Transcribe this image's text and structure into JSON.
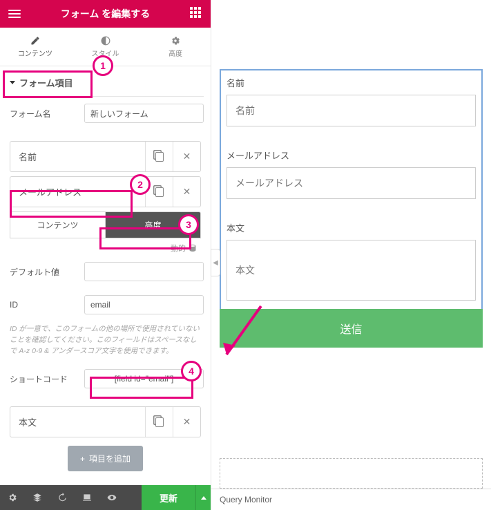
{
  "header": {
    "title": "フォーム を編集する"
  },
  "tabs": [
    {
      "label": "コンテンツ"
    },
    {
      "label": "スタイル"
    },
    {
      "label": "高度"
    }
  ],
  "section": {
    "title": "フォーム項目"
  },
  "form_name": {
    "label": "フォーム名",
    "value": "新しいフォーム"
  },
  "fields": [
    {
      "label": "名前"
    },
    {
      "label": "メールアドレス"
    },
    {
      "label": "本文"
    }
  ],
  "subtabs": [
    {
      "label": "コンテンツ"
    },
    {
      "label": "高度"
    }
  ],
  "dynamic_label": "動的",
  "default_value": {
    "label": "デフォルト値",
    "value": ""
  },
  "id_field": {
    "label": "ID",
    "value": "email"
  },
  "id_help": "ID が一意で、このフォームの他の場所で使用されていないことを確認してください。このフィールドはスペースなしで A-z 0-9 & アンダースコア文字を使用できます。",
  "shortcode": {
    "label": "ショートコード",
    "value": "[field id=\"email\"]"
  },
  "add_item_label": "項目を追加",
  "footer": {
    "update_label": "更新"
  },
  "preview": {
    "fields": [
      {
        "label": "名前",
        "placeholder": "名前"
      },
      {
        "label": "メールアドレス",
        "placeholder": "メールアドレス"
      },
      {
        "label": "本文",
        "placeholder": "本文"
      }
    ],
    "submit_label": "送信",
    "qm_label": "Query Monitor"
  },
  "annotations": {
    "n1": "1",
    "n2": "2",
    "n3": "3",
    "n4": "4"
  }
}
